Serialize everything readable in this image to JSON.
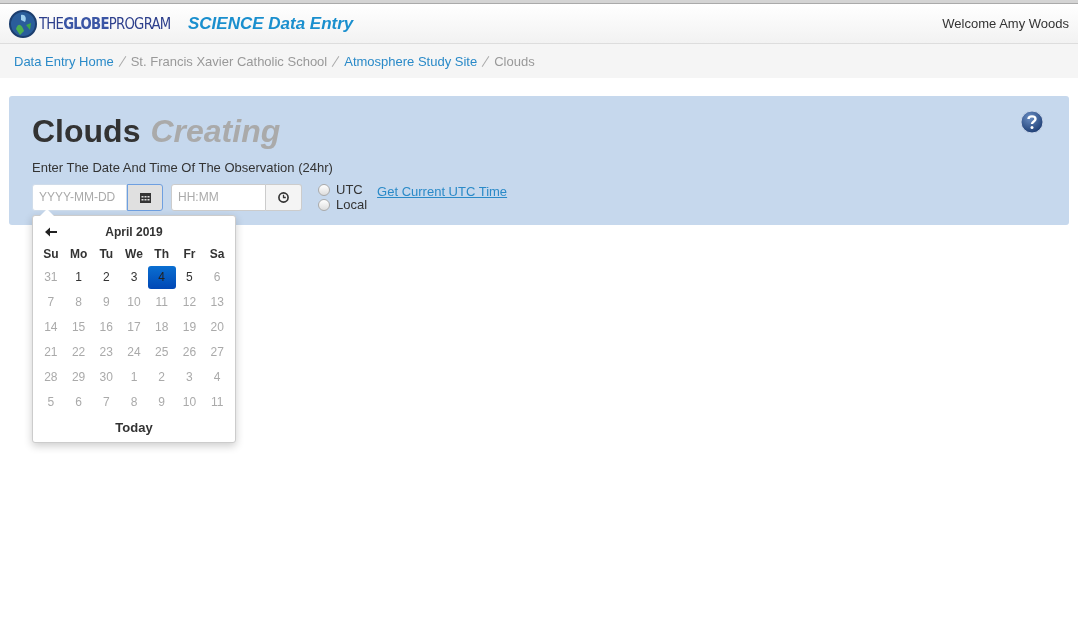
{
  "header": {
    "logo_text": "THE**GLOBE**PROGRAM",
    "app_title": "SCIENCE Data Entry",
    "welcome": "Welcome Amy Woods"
  },
  "breadcrumb": [
    {
      "label": "Data Entry Home",
      "link": true
    },
    {
      "label": "St. Francis Xavier Catholic School",
      "link": false
    },
    {
      "label": "Atmosphere Study Site",
      "link": true
    },
    {
      "label": "Clouds",
      "link": false
    }
  ],
  "panel": {
    "title": "Clouds",
    "status": "Creating",
    "prompt": "Enter The Date And Time Of The Observation (24hr)",
    "date_field": {
      "placeholder": "YYYY-MM-DD"
    },
    "time_field": {
      "placeholder": "HH:MM"
    },
    "timezone": [
      {
        "label": "UTC",
        "selected": false
      },
      {
        "label": "Local",
        "selected": false
      }
    ],
    "utc_link": "Get Current UTC Time"
  },
  "datepicker": {
    "month": "April 2019",
    "weekdays": [
      "Su",
      "Mo",
      "Tu",
      "We",
      "Th",
      "Fr",
      "Sa"
    ],
    "weeks": [
      [
        {
          "day": "31",
          "disabled": true,
          "selected": false
        },
        {
          "day": "1",
          "disabled": false,
          "selected": false
        },
        {
          "day": "2",
          "disabled": false,
          "selected": false
        },
        {
          "day": "3",
          "disabled": false,
          "selected": false
        },
        {
          "day": "4",
          "disabled": false,
          "selected": true
        },
        {
          "day": "5",
          "disabled": false,
          "selected": false
        },
        {
          "day": "6",
          "disabled": true,
          "selected": false
        }
      ],
      [
        {
          "day": "7",
          "disabled": true,
          "selected": false
        },
        {
          "day": "8",
          "disabled": true,
          "selected": false
        },
        {
          "day": "9",
          "disabled": true,
          "selected": false
        },
        {
          "day": "10",
          "disabled": true,
          "selected": false
        },
        {
          "day": "11",
          "disabled": true,
          "selected": false
        },
        {
          "day": "12",
          "disabled": true,
          "selected": false
        },
        {
          "day": "13",
          "disabled": true,
          "selected": false
        }
      ],
      [
        {
          "day": "14",
          "disabled": true,
          "selected": false
        },
        {
          "day": "15",
          "disabled": true,
          "selected": false
        },
        {
          "day": "16",
          "disabled": true,
          "selected": false
        },
        {
          "day": "17",
          "disabled": true,
          "selected": false
        },
        {
          "day": "18",
          "disabled": true,
          "selected": false
        },
        {
          "day": "19",
          "disabled": true,
          "selected": false
        },
        {
          "day": "20",
          "disabled": true,
          "selected": false
        }
      ],
      [
        {
          "day": "21",
          "disabled": true,
          "selected": false
        },
        {
          "day": "22",
          "disabled": true,
          "selected": false
        },
        {
          "day": "23",
          "disabled": true,
          "selected": false
        },
        {
          "day": "24",
          "disabled": true,
          "selected": false
        },
        {
          "day": "25",
          "disabled": true,
          "selected": false
        },
        {
          "day": "26",
          "disabled": true,
          "selected": false
        },
        {
          "day": "27",
          "disabled": true,
          "selected": false
        }
      ],
      [
        {
          "day": "28",
          "disabled": true,
          "selected": false
        },
        {
          "day": "29",
          "disabled": true,
          "selected": false
        },
        {
          "day": "30",
          "disabled": true,
          "selected": false
        },
        {
          "day": "1",
          "disabled": true,
          "selected": false
        },
        {
          "day": "2",
          "disabled": true,
          "selected": false
        },
        {
          "day": "3",
          "disabled": true,
          "selected": false
        },
        {
          "day": "4",
          "disabled": true,
          "selected": false
        }
      ],
      [
        {
          "day": "5",
          "disabled": true,
          "selected": false
        },
        {
          "day": "6",
          "disabled": true,
          "selected": false
        },
        {
          "day": "7",
          "disabled": true,
          "selected": false
        },
        {
          "day": "8",
          "disabled": true,
          "selected": false
        },
        {
          "day": "9",
          "disabled": true,
          "selected": false
        },
        {
          "day": "10",
          "disabled": true,
          "selected": false
        },
        {
          "day": "11",
          "disabled": true,
          "selected": false
        }
      ]
    ],
    "today": "Today"
  }
}
